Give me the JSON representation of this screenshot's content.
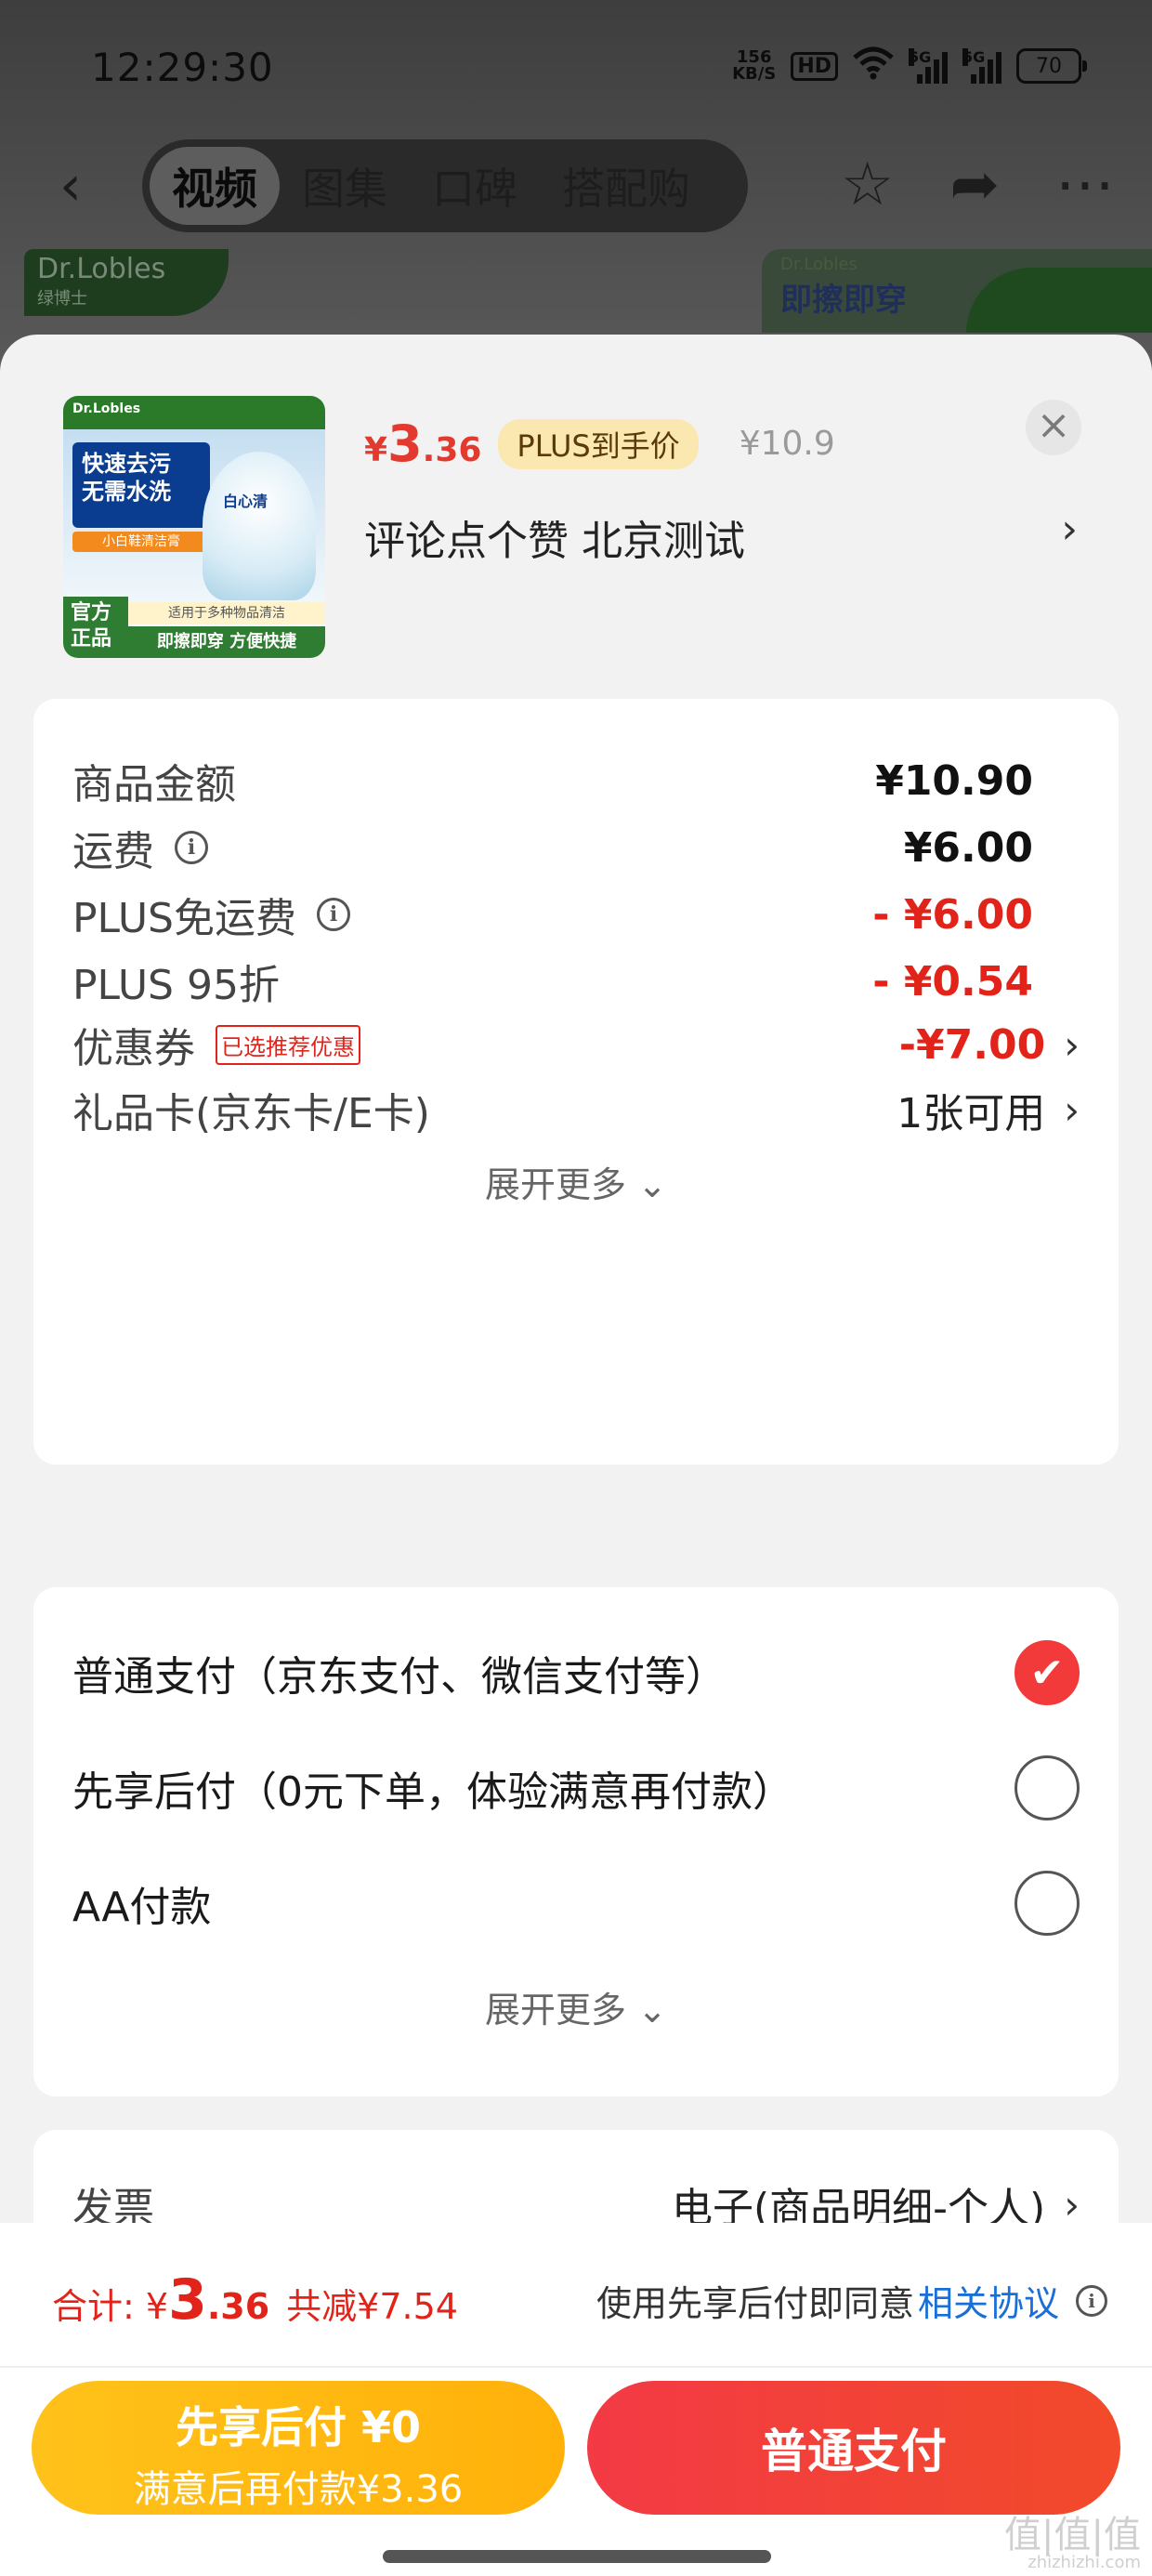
{
  "status_bar": {
    "time": "12:29:30",
    "net_speed_top": "156",
    "net_speed_bottom": "KB/S",
    "hd": "HD",
    "signal1": "5G",
    "signal2": "5G",
    "battery": "70"
  },
  "nav": {
    "tabs": [
      "视频",
      "图集",
      "口碑",
      "搭配购"
    ],
    "active_tab": "视频"
  },
  "banner": {
    "left_brand": "Dr.Lobles",
    "left_sub": "绿博士",
    "right_brand": "Dr.Lobles",
    "right_text": "即擦即穿"
  },
  "product": {
    "thumb_brand": "Dr.Lobles",
    "thumb_headline": "快速去污 无需水洗",
    "thumb_sub": "小白鞋清洁膏",
    "thumb_jar_label": "白心清",
    "thumb_official": "官方正品",
    "thumb_hint": "适用于多种物品清洁",
    "thumb_bottom": "即擦即穿 方便快捷",
    "price_symbol": "¥",
    "price_int": "3",
    "price_dec": ".36",
    "plus_tag": "PLUS到手价",
    "original_price": "¥10.9",
    "name": "评论点个赞  北京测试"
  },
  "fees": {
    "rows": [
      {
        "label": "商品金额",
        "value": "¥10.90"
      },
      {
        "label": "运费",
        "value": "¥6.00"
      },
      {
        "label": "PLUS免运费",
        "value": "- ¥6.00"
      },
      {
        "label": "PLUS 95折",
        "value": "- ¥0.54"
      },
      {
        "label": "优惠券",
        "tag": "已选推荐优惠",
        "value": "-¥7.00"
      },
      {
        "label": "礼品卡(京东卡/E卡)",
        "value": "1张可用"
      }
    ],
    "expand": "展开更多 ⌄"
  },
  "payment": {
    "options": [
      {
        "label": "普通支付（京东支付、微信支付等）",
        "checked": true
      },
      {
        "label": "先享后付（0元下单，体验满意再付款）",
        "checked": false
      },
      {
        "label": "AA付款",
        "checked": false
      }
    ],
    "expand": "展开更多 ⌄"
  },
  "invoice": {
    "label": "发票",
    "value": "电子(商品明细-个人)"
  },
  "bottom": {
    "total_label": "合计: ¥",
    "total_int": "3",
    "total_dec": ".36",
    "saved": "共减¥7.54",
    "agree_text": "使用先享后付即同意",
    "agree_link": "相关协议",
    "btn_later_line1": "先享后付 ¥0",
    "btn_later_line2": "满意后再付款¥3.36",
    "btn_normal": "普通支付",
    "watermark": "值|值|值",
    "watermark_url": "zhizhizhi.com"
  },
  "colors": {
    "accent_red": "#e2231a",
    "plus_gold": "#fbe7b0",
    "later_yellow": "#ffb10a",
    "link_blue": "#1a6fd6"
  }
}
